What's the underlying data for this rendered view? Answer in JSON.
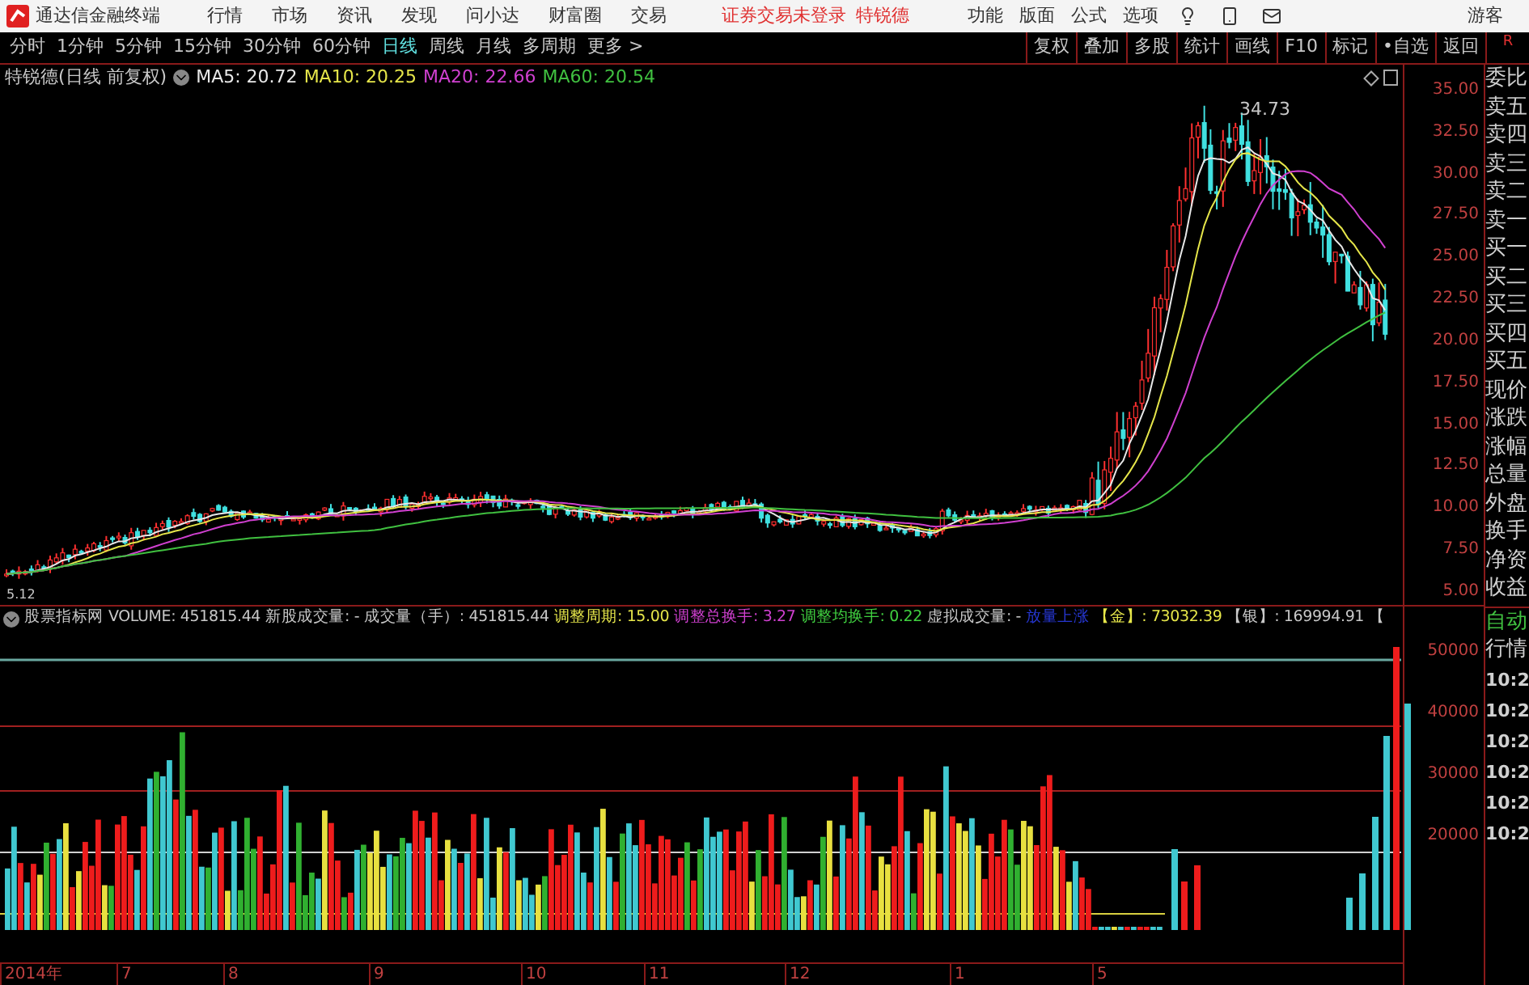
{
  "menubar": {
    "app_title": "通达信金融终端",
    "menus": [
      "行情",
      "市场",
      "资讯",
      "发现",
      "问小达",
      "财富圈",
      "交易"
    ],
    "login_status": "证券交易未登录",
    "stock_name": "特锐德",
    "tools": [
      "功能",
      "版面",
      "公式",
      "选项"
    ],
    "user": "游客"
  },
  "period_tabs": [
    {
      "label": "分时",
      "selected": false
    },
    {
      "label": "1分钟",
      "selected": false
    },
    {
      "label": "5分钟",
      "selected": false
    },
    {
      "label": "15分钟",
      "selected": false
    },
    {
      "label": "30分钟",
      "selected": false
    },
    {
      "label": "60分钟",
      "selected": false
    },
    {
      "label": "日线",
      "selected": true
    },
    {
      "label": "周线",
      "selected": false
    },
    {
      "label": "月线",
      "selected": false
    },
    {
      "label": "多周期",
      "selected": false
    },
    {
      "label": "更多 >",
      "selected": false
    }
  ],
  "toolbar_buttons": [
    "复权",
    "叠加",
    "多股",
    "统计",
    "画线",
    "F10",
    "标记",
    "•自选",
    "返回"
  ],
  "corner_label": "R",
  "price_panel": {
    "title": "特锐德(日线 前复权)",
    "ma": [
      {
        "label": "MA5: 20.72",
        "color": "#e8e8e8"
      },
      {
        "label": "MA10: 20.25",
        "color": "#e6e64a"
      },
      {
        "label": "MA20: 22.66",
        "color": "#d040d0"
      },
      {
        "label": "MA60: 20.54",
        "color": "#40c040"
      }
    ],
    "high_label": "34.73",
    "low_label": "5.12",
    "axis_labels": [
      "35.00",
      "32.50",
      "30.00",
      "27.50",
      "25.00",
      "22.50",
      "20.00",
      "17.50",
      "15.00",
      "12.50",
      "10.00",
      "7.50",
      "5.00"
    ]
  },
  "quote_labels": [
    "委比",
    "卖五",
    "卖四",
    "卖三",
    "卖二",
    "卖一",
    "买一",
    "买二",
    "买三",
    "买四",
    "买五",
    "现价",
    "涨跌",
    "涨幅",
    "总量",
    "外盘",
    "换手",
    "净资",
    "收益"
  ],
  "volume_panel": {
    "indicators": [
      {
        "label": "股票指标网"
      },
      {
        "label": "VOLUME:",
        "value": "451815.44"
      },
      {
        "label": "新股成交量:",
        "value": "-"
      },
      {
        "label": "成交量（手）:",
        "value": "451815.44"
      },
      {
        "label": "调整周期:",
        "value": "15.00",
        "color": "#e6e64a"
      },
      {
        "label": "调整总换手:",
        "value": "3.27",
        "color": "#d040d0"
      },
      {
        "label": "调整均换手:",
        "value": "0.22",
        "color": "#40d040"
      },
      {
        "label": "虚拟成交量:",
        "value": "-"
      },
      {
        "label": "放量上涨",
        "color": "#2636d0"
      },
      {
        "label": "【金】:",
        "value": "73032.39",
        "color": "#e6e64a"
      },
      {
        "label": "【银】:",
        "value": "169994.91"
      },
      {
        "label": "【"
      }
    ],
    "axis_labels": [
      "50000",
      "40000",
      "30000",
      "20000"
    ]
  },
  "side_bottom": [
    "自动",
    "行情"
  ],
  "times": [
    "10:2",
    "10:2",
    "10:2",
    "10:2",
    "10:2",
    "10:2"
  ],
  "date_axis": [
    "2014年",
    "7",
    "8",
    "9",
    "10",
    "11",
    "12",
    "1",
    "5"
  ]
}
